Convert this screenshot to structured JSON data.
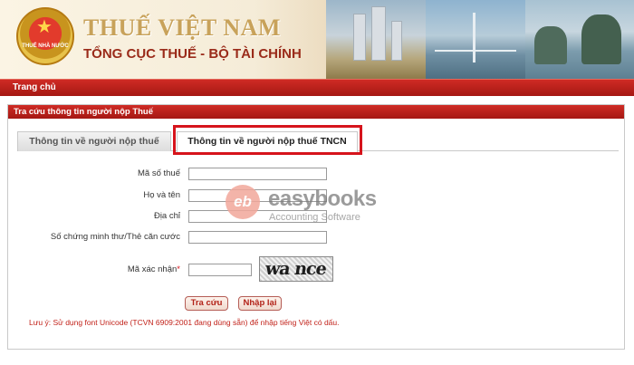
{
  "header": {
    "emblem_text": "THUẾ NHÀ NƯỚC",
    "title": "THUẾ VIỆT NAM",
    "subtitle": "TỔNG CỤC THUẾ - BỘ TÀI CHÍNH"
  },
  "nav": {
    "home_label": "Trang chủ"
  },
  "panel": {
    "title": "Tra cứu thông tin người nộp Thuế"
  },
  "tabs": [
    {
      "label": "Thông tin về người nộp thuế",
      "active": false
    },
    {
      "label": "Thông tin về người nộp thuế TNCN",
      "active": true
    }
  ],
  "form": {
    "tax_code_label": "Mã số thuế",
    "tax_code_value": "",
    "full_name_label": "Họ và tên",
    "full_name_value": "",
    "address_label": "Địa chỉ",
    "address_value": "",
    "id_card_label": "Số chứng minh thư/Thẻ căn cước",
    "id_card_value": "",
    "captcha_label": "Mã xác nhận",
    "captcha_required_mark": "*",
    "captcha_value": "",
    "captcha_image_text": "wa nce"
  },
  "buttons": {
    "search_label": "Tra cứu",
    "reset_label": "Nhập lại"
  },
  "note": "Lưu ý: Sử dụng font Unicode (TCVN 6909:2001 đang dùng sẵn) để nhập tiếng Việt có dấu.",
  "watermark": {
    "logo_text": "eb",
    "brand": "easybooks",
    "tagline": "Accounting Software"
  },
  "colors": {
    "brand_red": "#c8221b",
    "highlight_border": "#d6141c",
    "title_gold": "#c8a25a"
  }
}
